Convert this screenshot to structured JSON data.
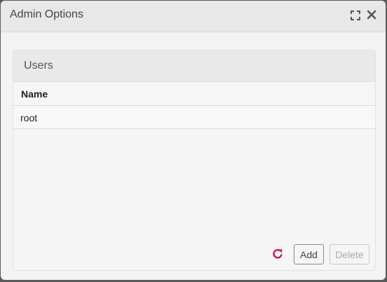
{
  "dialog": {
    "title": "Admin Options",
    "icons": {
      "maximize": "maximize-icon",
      "close": "close-icon"
    }
  },
  "users_panel": {
    "title": "Users",
    "columns": [
      "Name"
    ],
    "rows": [
      {
        "name": "root"
      }
    ],
    "actions": {
      "refresh_icon": "refresh-icon",
      "add_label": "Add",
      "delete_label": "Delete"
    }
  },
  "colors": {
    "refresh": "#c8174a",
    "title_bar": "#e8e8e8",
    "panel_header": "#e9e9e9"
  }
}
